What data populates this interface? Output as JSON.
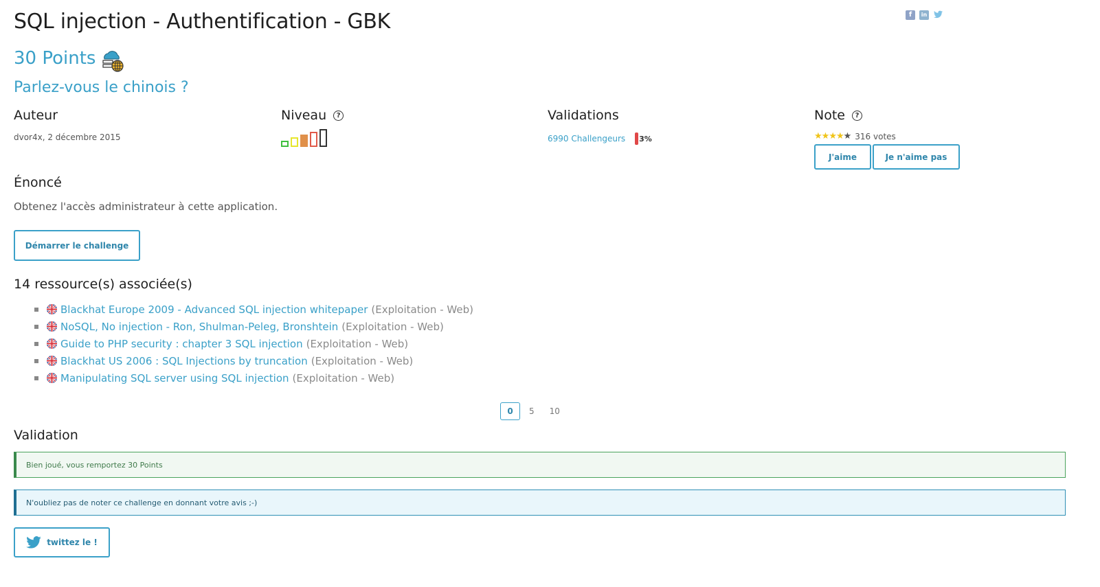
{
  "header": {
    "title": "SQL injection - Authentification - GBK",
    "points": "30 Points",
    "subtitle": "Parlez-vous le chinois ?"
  },
  "share": {
    "facebook": "f",
    "linkedin": "in",
    "twitter": "t"
  },
  "author": {
    "heading": "Auteur",
    "text": "dvor4x,  2 décembre 2015"
  },
  "level": {
    "heading": "Niveau",
    "help": "?",
    "bars": [
      {
        "color": "#3fbf3f",
        "filled": false
      },
      {
        "color": "#e6e62c",
        "filled": false
      },
      {
        "color": "#e0904a",
        "filled": true
      },
      {
        "color": "#e05a4a",
        "filled": false
      },
      {
        "color": "#333333",
        "filled": false
      }
    ]
  },
  "validations": {
    "heading": "Validations",
    "link": "6990 Challengeurs",
    "percent": "3%"
  },
  "note": {
    "heading": "Note",
    "help": "?",
    "stars": 4,
    "stars_max": 5,
    "votes": "316 votes",
    "like_label": "J'aime",
    "dislike_label": "Je n'aime pas"
  },
  "enonce": {
    "heading": "Énoncé",
    "text": "Obtenez l'accès administrateur à cette application.",
    "start_label": "Démarrer le challenge"
  },
  "resources": {
    "heading": "14 ressource(s) associée(s)",
    "items": [
      {
        "title": "Blackhat Europe 2009 - Advanced SQL injection whitepaper",
        "category": "(Exploitation - Web)"
      },
      {
        "title": "NoSQL, No injection - Ron, Shulman-Peleg, Bronshtein",
        "category": "(Exploitation - Web)"
      },
      {
        "title": "Guide to PHP security : chapter 3 SQL injection",
        "category": "(Exploitation - Web)"
      },
      {
        "title": "Blackhat US 2006 : SQL Injections by truncation",
        "category": "(Exploitation - Web)"
      },
      {
        "title": "Manipulating SQL server using SQL injection",
        "category": "(Exploitation - Web)"
      }
    ]
  },
  "pagination": {
    "pages": [
      "0",
      "5",
      "10"
    ],
    "current": "0"
  },
  "validation": {
    "heading": "Validation",
    "success_message": "Bien joué, vous remportez 30 Points",
    "info_message": "N'oubliez pas de noter ce challenge en donnant votre avis ;-)",
    "tweet_label": "twittez le !"
  },
  "colors": {
    "accent": "#3aa0c8",
    "success": "#3a8a4c",
    "info": "#1f6f92"
  }
}
